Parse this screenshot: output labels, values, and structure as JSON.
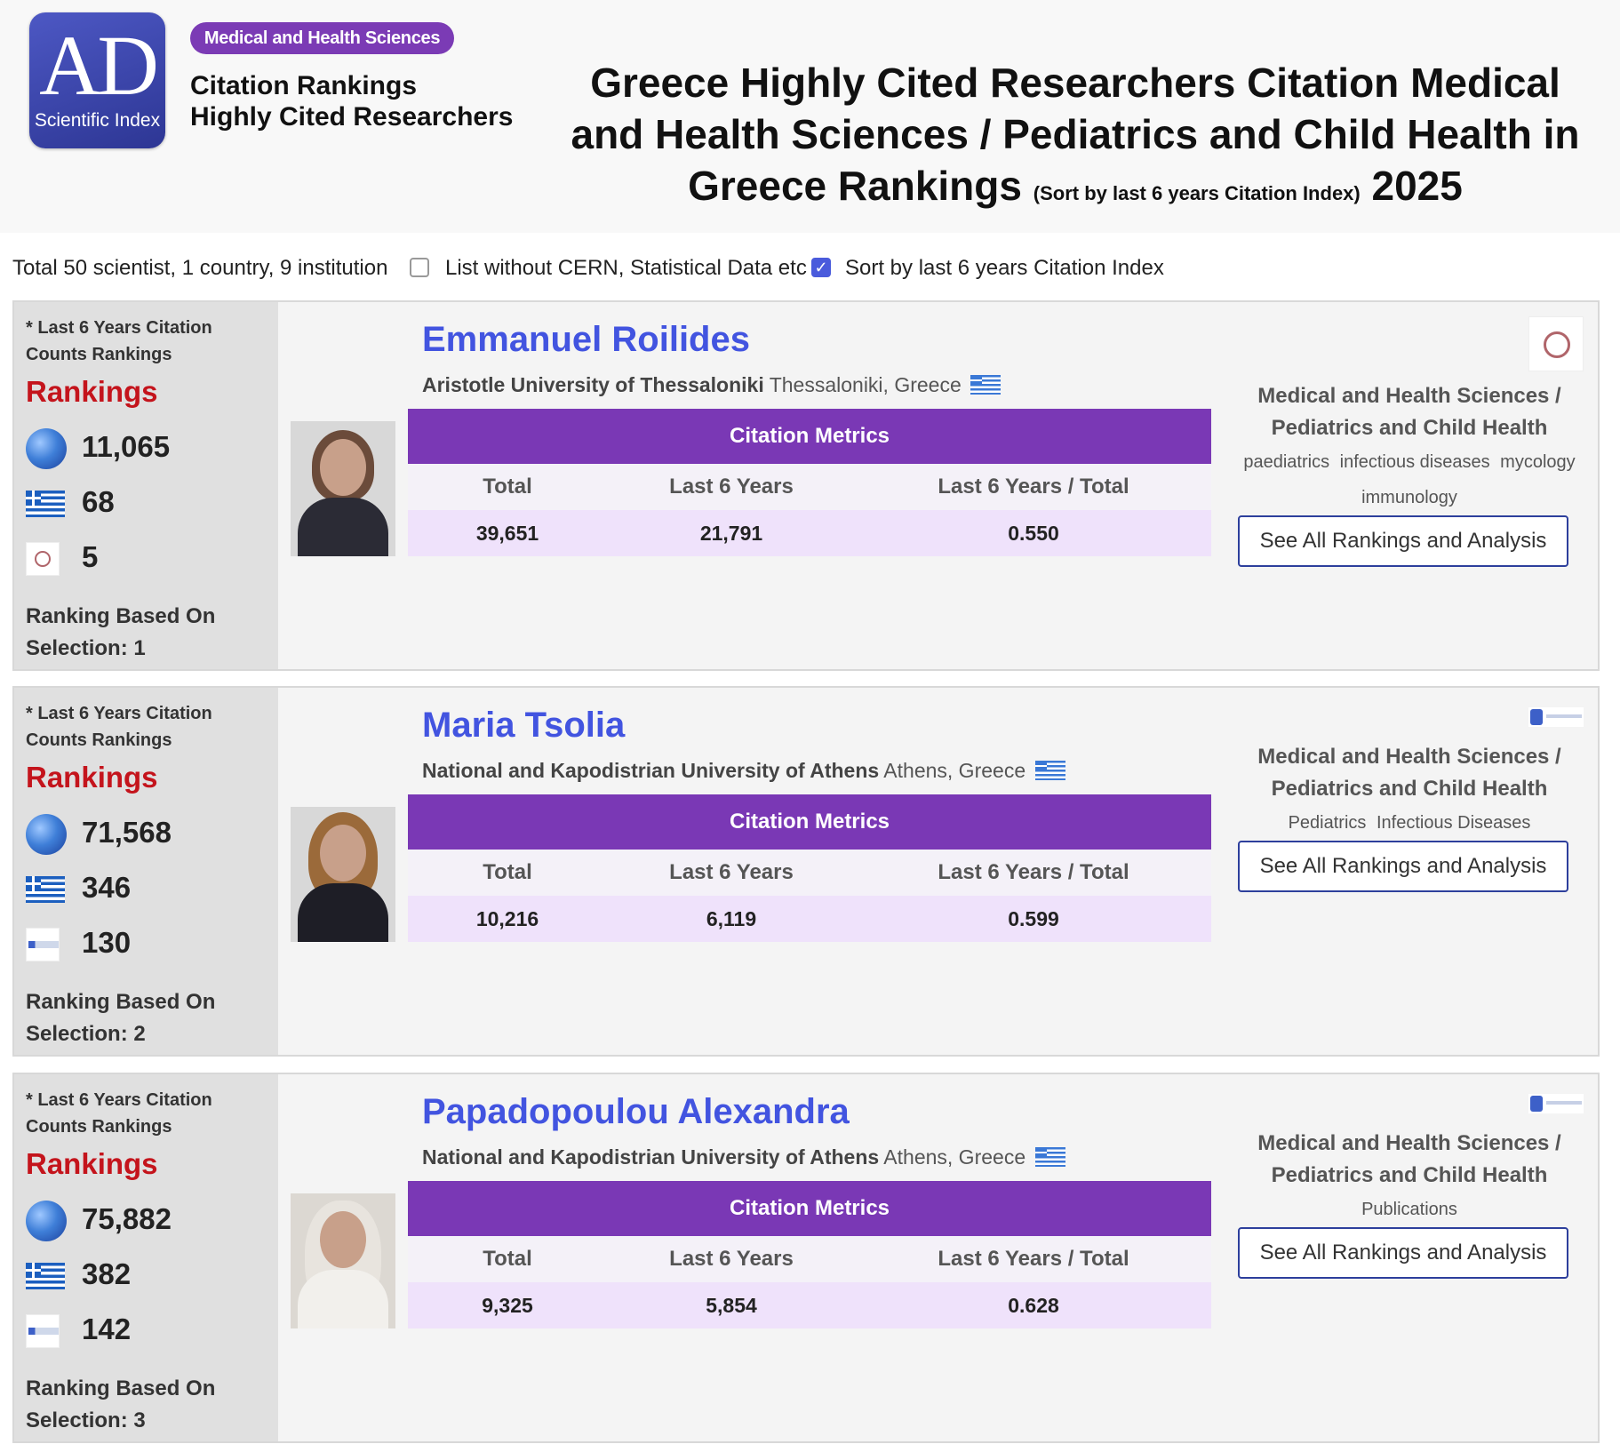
{
  "header": {
    "logo": {
      "big": "AD",
      "small": "Scientific Index"
    },
    "badge": "Medical and Health Sciences",
    "brand_line1": "Citation Rankings",
    "brand_line2": "Highly Cited Researchers",
    "title_line1": "Greece Highly Cited Researchers Citation Medical",
    "title_line2": "and Health Sciences / Pediatrics and Child Health in",
    "title_line3_a": "Greece Rankings",
    "title_line3_small": "(Sort by last 6 years Citation Index)",
    "title_line3_b": "2025"
  },
  "filters": {
    "summary": "Total 50 scientist, 1 country, 9 institution",
    "option1": {
      "label": "List without CERN, Statistical Data etc",
      "checked": false
    },
    "option2": {
      "label": "Sort by last 6 years Citation Index",
      "checked": true
    }
  },
  "common": {
    "left_label": "* Last 6 Years Citation Counts Rankings",
    "rankings_title": "Rankings",
    "metrics_header": "Citation Metrics",
    "col_total": "Total",
    "col_last6": "Last 6 Years",
    "col_ratio": "Last 6 Years / Total",
    "field_line1": "Medical and Health Sciences /",
    "field_line2": "Pediatrics and Child Health",
    "button_label": "See All Rankings and Analysis"
  },
  "researchers": [
    {
      "name": "Emmanuel Roilides",
      "institution": "Aristotle University of Thessaloniki",
      "location": "Thessaloniki, Greece",
      "world_rank": "11,065",
      "country_rank": "68",
      "institution_rank": "5",
      "basis": "Ranking Based On",
      "selection": "Selection: 1",
      "total": "39,651",
      "last6": "21,791",
      "ratio": "0.550",
      "keywords_line1": [
        "paediatrics",
        "infectious diseases",
        "mycology"
      ],
      "keywords_line2": [
        "immunology"
      ]
    },
    {
      "name": "Maria Tsolia",
      "institution": "National and Kapodistrian University of Athens",
      "location": "Athens, Greece",
      "world_rank": "71,568",
      "country_rank": "346",
      "institution_rank": "130",
      "basis": "Ranking Based On",
      "selection": "Selection: 2",
      "total": "10,216",
      "last6": "6,119",
      "ratio": "0.599",
      "keywords_line1": [
        "Pediatrics",
        "Infectious Diseases"
      ],
      "keywords_line2": []
    },
    {
      "name": "Papadopoulou Alexandra",
      "institution": "National and Kapodistrian University of Athens",
      "location": "Athens, Greece",
      "world_rank": "75,882",
      "country_rank": "382",
      "institution_rank": "142",
      "basis": "Ranking Based On",
      "selection": "Selection: 3",
      "total": "9,325",
      "last6": "5,854",
      "ratio": "0.628",
      "keywords_line1": [
        "Publications"
      ],
      "keywords_line2": []
    }
  ]
}
